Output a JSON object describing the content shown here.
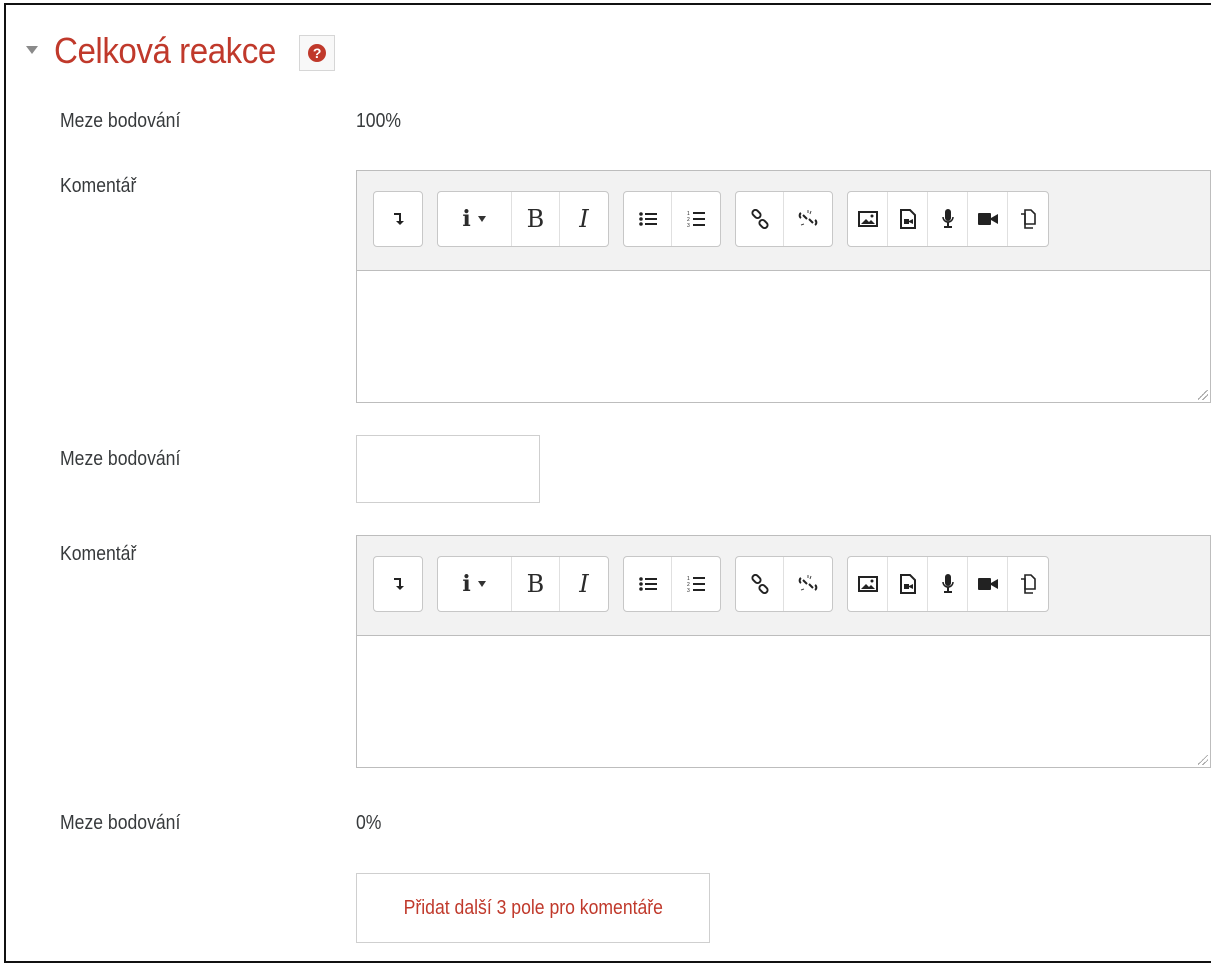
{
  "section": {
    "title": "Celková reakce",
    "help_icon": "help-icon",
    "help_glyph": "?"
  },
  "rows": {
    "grade_limit_1": {
      "label": "Meze bodování",
      "value": "100%"
    },
    "feedback_1": {
      "label": "Komentář"
    },
    "grade_limit_2": {
      "label": "Meze bodování",
      "input_value": ""
    },
    "feedback_2": {
      "label": "Komentář"
    },
    "grade_limit_3": {
      "label": "Meze bodování",
      "value": "0%"
    }
  },
  "toolbar": {
    "groups": [
      [
        "collapse-toolbar-icon"
      ],
      [
        "paragraph-styles-icon",
        "bold-icon",
        "italic-icon"
      ],
      [
        "unordered-list-icon",
        "ordered-list-icon"
      ],
      [
        "link-icon",
        "unlink-icon"
      ],
      [
        "image-icon",
        "media-icon",
        "record-audio-icon",
        "record-video-icon",
        "manage-files-icon"
      ]
    ],
    "glyphs": {
      "bold": "B",
      "italic": "I",
      "styles": "i"
    }
  },
  "add_button": {
    "label": "Přidat další 3 pole pro komentáře"
  },
  "colors": {
    "accent": "#c0392b",
    "border": "#bdbdbd",
    "toolbar_bg": "#f2f2f2",
    "text": "#373a3c"
  }
}
